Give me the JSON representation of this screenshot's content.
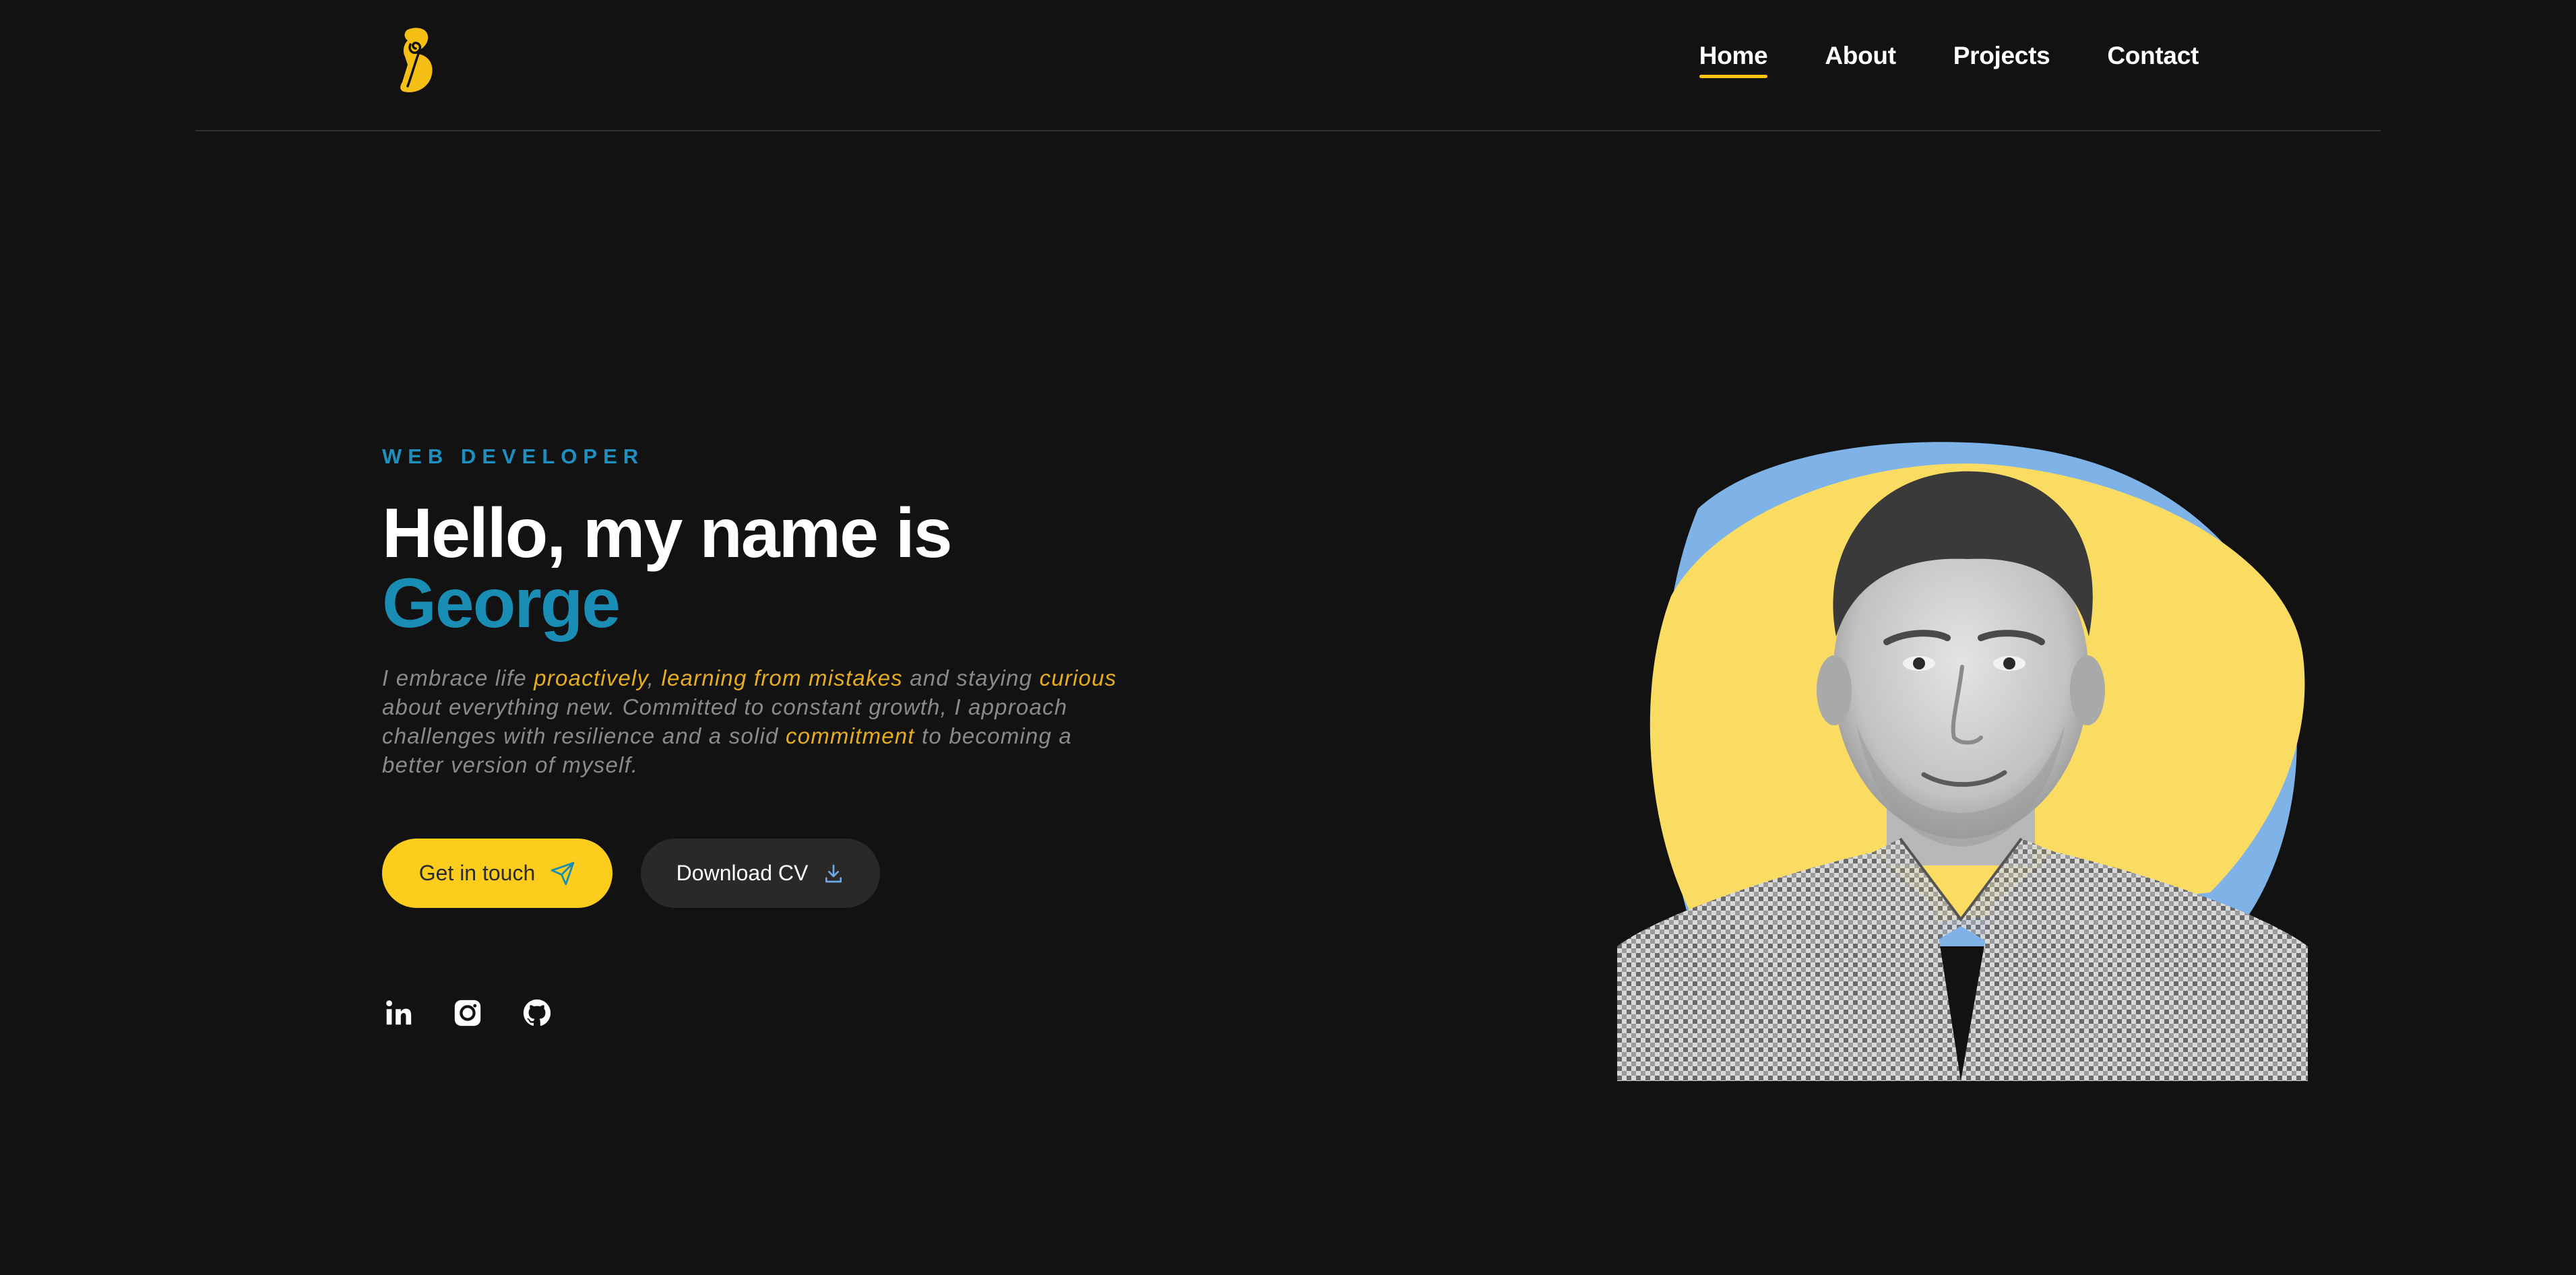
{
  "header": {
    "logo": "B",
    "nav": [
      {
        "label": "Home",
        "active": true
      },
      {
        "label": "About",
        "active": false
      },
      {
        "label": "Projects",
        "active": false
      },
      {
        "label": "Contact",
        "active": false
      }
    ]
  },
  "hero": {
    "eyebrow": "WEB DEVELOPER",
    "headline": "Hello, my name is",
    "name": "George",
    "bio": {
      "p1": "I embrace life ",
      "h1": "proactively",
      "p2": ", ",
      "h2": "learning from mistakes",
      "p3": " and staying ",
      "h3": "curious",
      "p4": " about everything new. Committed to constant growth, I approach challenges with resilience and a solid ",
      "h4": "commitment",
      "p5": " to becoming a better version of myself."
    },
    "buttons": {
      "primary": "Get in touch",
      "secondary": "Download CV"
    },
    "socials": [
      "linkedin-icon",
      "instagram-icon",
      "github-icon"
    ]
  },
  "colors": {
    "background": "#121212",
    "accent_yellow": "#fccd1d",
    "accent_blue": "#1a8db5",
    "blob_yellow": "#fbdc63",
    "blob_blue": "#7fb3e8"
  }
}
